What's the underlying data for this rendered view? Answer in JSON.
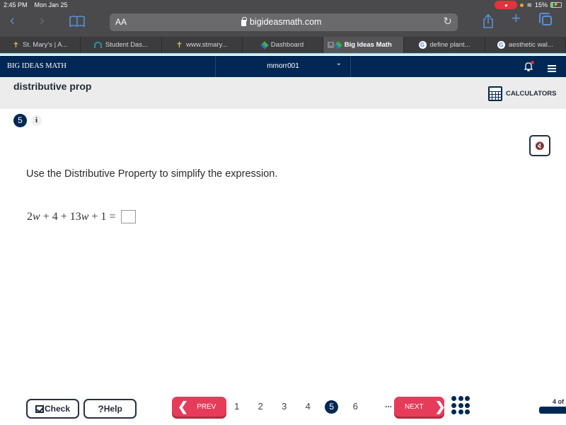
{
  "status_bar": {
    "time": "2:45 PM",
    "date": "Mon Jan 25",
    "battery_percent": "15%",
    "mic_active": true
  },
  "browser": {
    "text_size_label": "AA",
    "url": "bigideasmath.com",
    "tabs": [
      {
        "label": "St. Mary's | A...",
        "favicon": "tree-icon",
        "active": false
      },
      {
        "label": "Student Das...",
        "favicon": "dashboard-icon",
        "active": false
      },
      {
        "label": "www.stmary...",
        "favicon": "tree-icon",
        "active": false
      },
      {
        "label": "Dashboard",
        "favicon": "big-ideas-icon",
        "active": false
      },
      {
        "label": "Big Ideas Math",
        "favicon": "big-ideas-icon",
        "active": true
      },
      {
        "label": "define plant...",
        "favicon": "google-icon",
        "active": false
      },
      {
        "label": "aesthetic wal...",
        "favicon": "google-icon",
        "active": false
      }
    ]
  },
  "header": {
    "brand": "BIG IDEAS MATH",
    "username": "mmorr001",
    "notification_dot": true
  },
  "assignment": {
    "title": "distributive prop",
    "calculators_label": "CALCULATORS"
  },
  "question": {
    "number": "5",
    "info_label": "i",
    "prompt": "Use the Distributive Property to simplify the expression.",
    "equation_parts": [
      "2",
      "w",
      " + 4 + 13",
      "w",
      " + 1 ="
    ],
    "answer_value": ""
  },
  "footer": {
    "check_label": "Check",
    "help_label": "Help",
    "help_glyph": "?",
    "prev_label": "PREV",
    "next_label": "NEXT",
    "pages": [
      "1",
      "2",
      "3",
      "4",
      "5",
      "6"
    ],
    "current_page": "5",
    "ellipsis": "...",
    "progress_label": "4 of"
  },
  "colors": {
    "navy": "#012855",
    "accent_red": "#e63c5a",
    "browser_dark": "#4a4a4c",
    "link_blue": "#5a8fd6"
  }
}
